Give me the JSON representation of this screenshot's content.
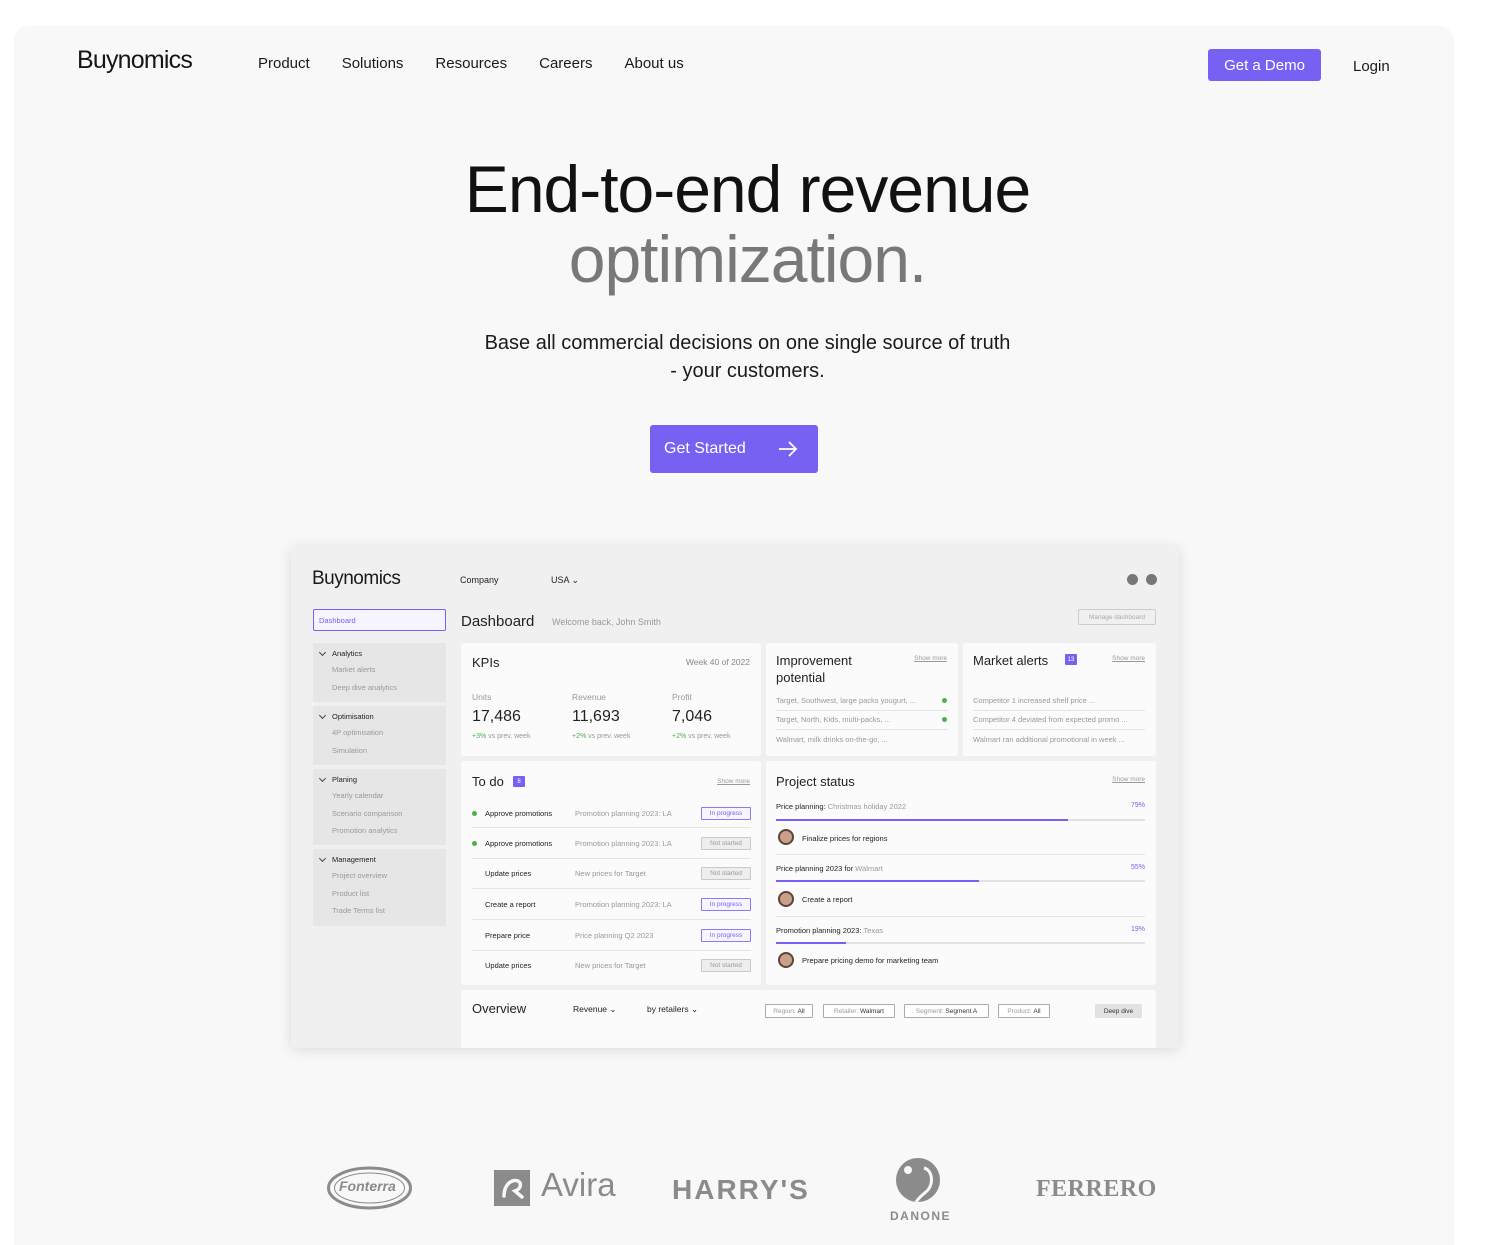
{
  "brand": "Buynomics",
  "nav": {
    "items": [
      "Product",
      "Solutions",
      "Resources",
      "Careers",
      "About us"
    ],
    "demo": "Get a Demo",
    "login": "Login"
  },
  "hero": {
    "title_line1": "End-to-end revenue",
    "title_line2": "optimization.",
    "subtitle_line1": "Base all commercial decisions on one single source of truth",
    "subtitle_line2": "- your customers.",
    "cta": "Get Started"
  },
  "colors": {
    "accent": "#7661f2",
    "success": "#4caf50"
  },
  "dashboard": {
    "logo": "Buynomics",
    "company_label": "Company",
    "country": "USA",
    "title": "Dashboard",
    "welcome": "Welcome back, John Smith",
    "manage": "Manage dashboard",
    "sidebar": {
      "active": "Dashboard",
      "groups": [
        {
          "title": "Analytics",
          "items": [
            "Market alerts",
            "Deep dive analytics"
          ]
        },
        {
          "title": "Optimisation",
          "items": [
            "4P optimisation",
            "Simulation"
          ]
        },
        {
          "title": "Planing",
          "items": [
            "Yearly calendar",
            "Scenario comparison",
            "Promotion analytics"
          ]
        },
        {
          "title": "Management",
          "items": [
            "Project overview",
            "Product list",
            "Trade Terms list"
          ]
        }
      ]
    },
    "kpis": {
      "title": "KPIs",
      "week": "Week 40 of 2022",
      "items": [
        {
          "label": "Units",
          "value": "17,486",
          "change": "+3%",
          "suffix": "vs prev. week"
        },
        {
          "label": "Revenue",
          "value": "11,693",
          "change": "+2%",
          "suffix": "vs prev. week"
        },
        {
          "label": "Profit",
          "value": "7,046",
          "change": "+2%",
          "suffix": "vs prev. week"
        }
      ]
    },
    "improvement": {
      "title_line1": "Improvement",
      "title_line2": "potential",
      "show_more": "Show more",
      "rows": [
        "Target, Southwest, large packs yougurt, ...",
        "Target, North, Kids, multi-packs, ...",
        "Walmart, milk drinks on-the-go, ..."
      ]
    },
    "market_alerts": {
      "title": "Market alerts",
      "badge": "13",
      "show_more": "Show more",
      "rows": [
        "Competitor 1 increased shelf price ...",
        "Competitor 4 deviated from expected promo ...",
        "Walmart ran additional promotional in week ..."
      ]
    },
    "todo": {
      "title": "To do",
      "badge": "8",
      "show_more": "Show more",
      "rows": [
        {
          "task": "Approve promotions",
          "project": "Promotion planning 2023: LA",
          "status": "In progress"
        },
        {
          "task": "Approve promotions",
          "project": "Promotion planning 2023: LA",
          "status": "Not started"
        },
        {
          "task": "Update prices",
          "project": "New prices for Target",
          "status": "Not started"
        },
        {
          "task": "Create a report",
          "project": "Promotion planning 2023: LA",
          "status": "In progress"
        },
        {
          "task": "Prepare price",
          "project": "Price planning Q2 2023",
          "status": "In progress"
        },
        {
          "task": "Update prices",
          "project": "New prices for Target",
          "status": "Not started"
        }
      ]
    },
    "project_status": {
      "title": "Project status",
      "show_more": "Show more",
      "projects": [
        {
          "name": "Price planning:",
          "detail": "Christmas holiday 2022",
          "percent": "79%",
          "progress": 0.79,
          "task": "Finalize prices for regions"
        },
        {
          "name": "Price planning 2023 for",
          "detail": "Walmart",
          "percent": "55%",
          "progress": 0.55,
          "task": "Create a report"
        },
        {
          "name": "Promotion planning 2023:",
          "detail": "Texas",
          "percent": "19%",
          "progress": 0.19,
          "task": "Prepare pricing demo for marketing team"
        }
      ]
    },
    "overview": {
      "title": "Overview",
      "metric": "Revenue",
      "grouping": "by retailers",
      "filters": [
        {
          "key": "Region:",
          "value": "All"
        },
        {
          "key": "Retailer:",
          "value": "Walmart"
        },
        {
          "key": "Segment:",
          "value": "Segment A"
        },
        {
          "key": "Product:",
          "value": "All"
        }
      ],
      "deep_dive": "Deep dive"
    }
  },
  "logos": [
    "Fonterra",
    "Avira",
    "HARRY'S",
    "DANONE",
    "FERRERO"
  ]
}
